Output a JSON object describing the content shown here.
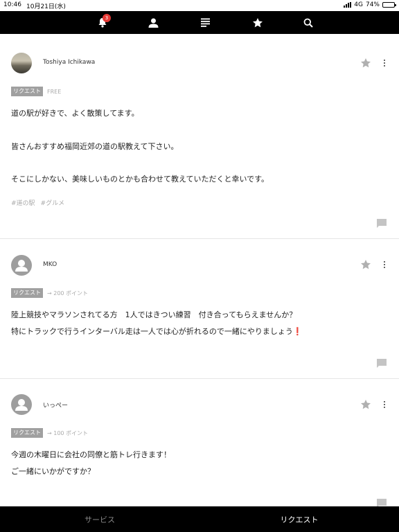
{
  "status_bar": {
    "time": "10:46",
    "date": "10月21日(水)",
    "network": "4G",
    "battery": "74%",
    "battery_level": 0.74
  },
  "top_nav": {
    "notification_count": "3",
    "icons": [
      "bell-icon",
      "user-icon",
      "list-icon",
      "star-icon",
      "search-icon"
    ]
  },
  "posts": [
    {
      "username": "Toshiya Ichikawa",
      "tag": "リクエスト",
      "reward": "FREE",
      "lines": [
        "道の駅が好きで、よく散策してます。",
        "皆さんおすすめ福岡近郊の道の駅教えて下さい。",
        "そこにしかない、美味しいものとかも合わせて教えていただくと幸いです。"
      ],
      "hashtags": [
        "#道の駅",
        "#グルメ"
      ]
    },
    {
      "username": "MKO",
      "tag": "リクエスト",
      "reward": "→ 200 ポイント",
      "lines": [
        "陸上競技やマラソンされてる方　1人ではきつい練習　付き合ってもらえませんか？",
        "特にトラックで行うインターバル走は一人では心が折れるので一緒にやりましょう❗"
      ]
    },
    {
      "username": "いっぺー",
      "tag": "リクエスト",
      "reward": "→ 100 ポイント",
      "lines": [
        "今週の木曜日に会社の同僚と筋トレ行きます！",
        "ご一緒にいかがですか？"
      ]
    }
  ],
  "bottom_tabs": {
    "service": "サービス",
    "request": "リクエスト",
    "active": "request"
  },
  "colors": {
    "nav_background": "#000000",
    "badge": "#e53935",
    "tag_background": "#a0a0a0",
    "muted_text": "#aaaaaa"
  }
}
